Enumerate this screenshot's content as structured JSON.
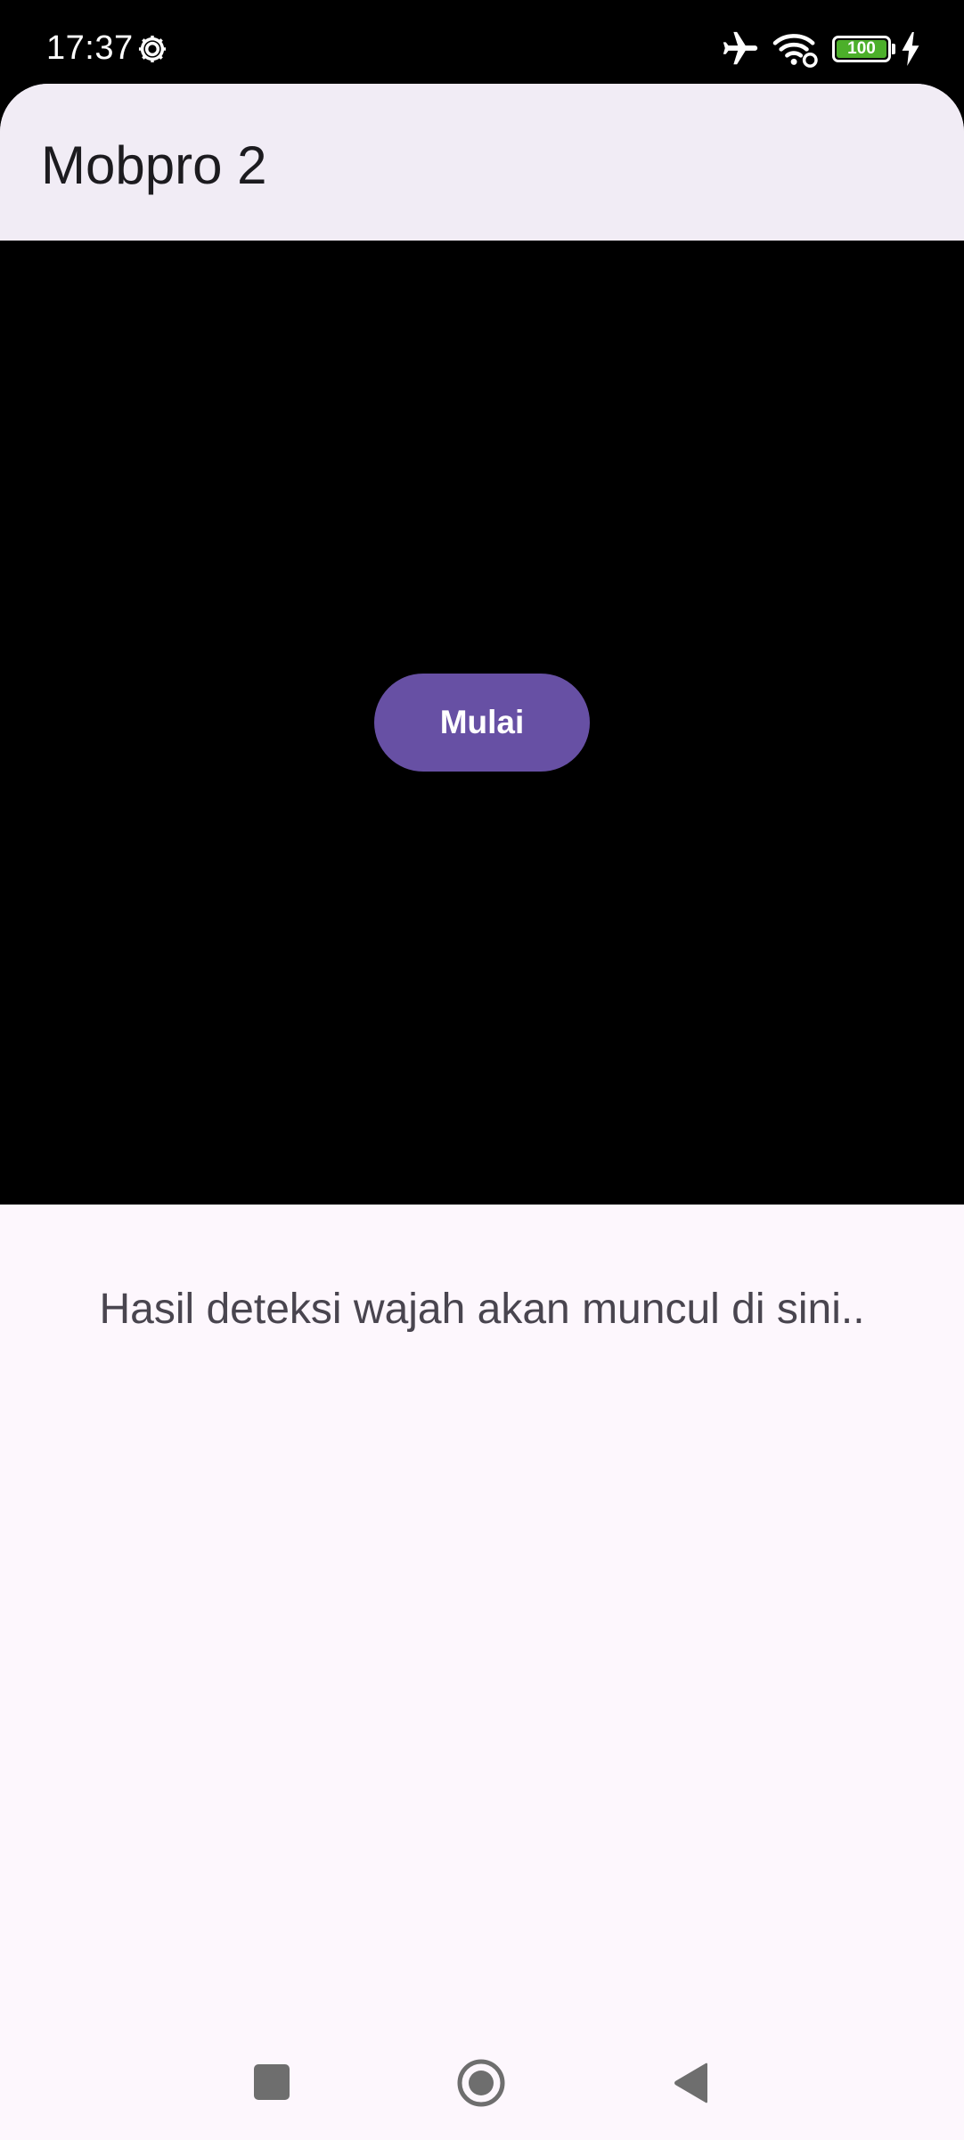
{
  "status_bar": {
    "time": "17:37",
    "battery_level": "100",
    "icons": [
      "gear-icon",
      "airplane-mode-icon",
      "wifi-icon",
      "battery-icon",
      "charging-icon"
    ]
  },
  "app_bar": {
    "title": "Mobpro 2"
  },
  "camera": {
    "start_button_label": "Mulai"
  },
  "result": {
    "placeholder": "Hasil deteksi wajah akan muncul di sini.."
  },
  "navigation": {
    "icons": [
      "recents-icon",
      "home-icon",
      "back-icon"
    ]
  },
  "colors": {
    "primary": "#6750a4",
    "app_bar_background": "#f1ecf5",
    "surface": "#fdf7fd",
    "battery_fill": "#4caf2a"
  }
}
